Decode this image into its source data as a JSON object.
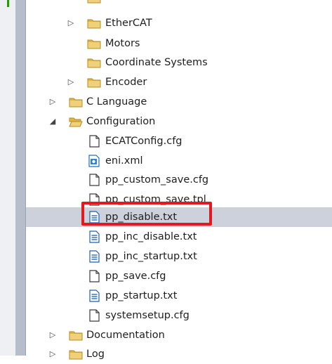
{
  "tree": {
    "items": [
      {
        "label": "",
        "icon": "folder-icon",
        "toggle": ""
      },
      {
        "label": "EtherCAT",
        "icon": "folder-icon",
        "toggle": "collapsed"
      },
      {
        "label": "Motors",
        "icon": "folder-icon",
        "toggle": ""
      },
      {
        "label": "Coordinate Systems",
        "icon": "folder-icon",
        "toggle": ""
      },
      {
        "label": "Encoder",
        "icon": "folder-icon",
        "toggle": "collapsed"
      },
      {
        "label": "C Language",
        "icon": "folder-icon",
        "toggle": "collapsed"
      },
      {
        "label": "Configuration",
        "icon": "folder-open-icon",
        "toggle": "expanded"
      },
      {
        "label": "ECATConfig.cfg",
        "icon": "file-icon",
        "toggle": ""
      },
      {
        "label": "eni.xml",
        "icon": "xml-file-icon",
        "toggle": ""
      },
      {
        "label": "pp_custom_save.cfg",
        "icon": "file-icon",
        "toggle": ""
      },
      {
        "label": "pp_custom_save.tpl",
        "icon": "file-icon",
        "toggle": ""
      },
      {
        "label": "pp_disable.txt",
        "icon": "text-file-icon",
        "toggle": "",
        "selected": true,
        "highlighted": true
      },
      {
        "label": "pp_inc_disable.txt",
        "icon": "text-file-icon",
        "toggle": ""
      },
      {
        "label": "pp_inc_startup.txt",
        "icon": "text-file-icon",
        "toggle": ""
      },
      {
        "label": "pp_save.cfg",
        "icon": "file-icon",
        "toggle": ""
      },
      {
        "label": "pp_startup.txt",
        "icon": "text-file-icon",
        "toggle": ""
      },
      {
        "label": "systemsetup.cfg",
        "icon": "file-icon",
        "toggle": ""
      },
      {
        "label": "Documentation",
        "icon": "folder-icon",
        "toggle": "collapsed"
      },
      {
        "label": "Log",
        "icon": "folder-icon",
        "toggle": "collapsed"
      }
    ]
  },
  "colors": {
    "selection": "#cdd1db",
    "highlight_box": "#e3191f",
    "folder": "#e8c15a"
  }
}
